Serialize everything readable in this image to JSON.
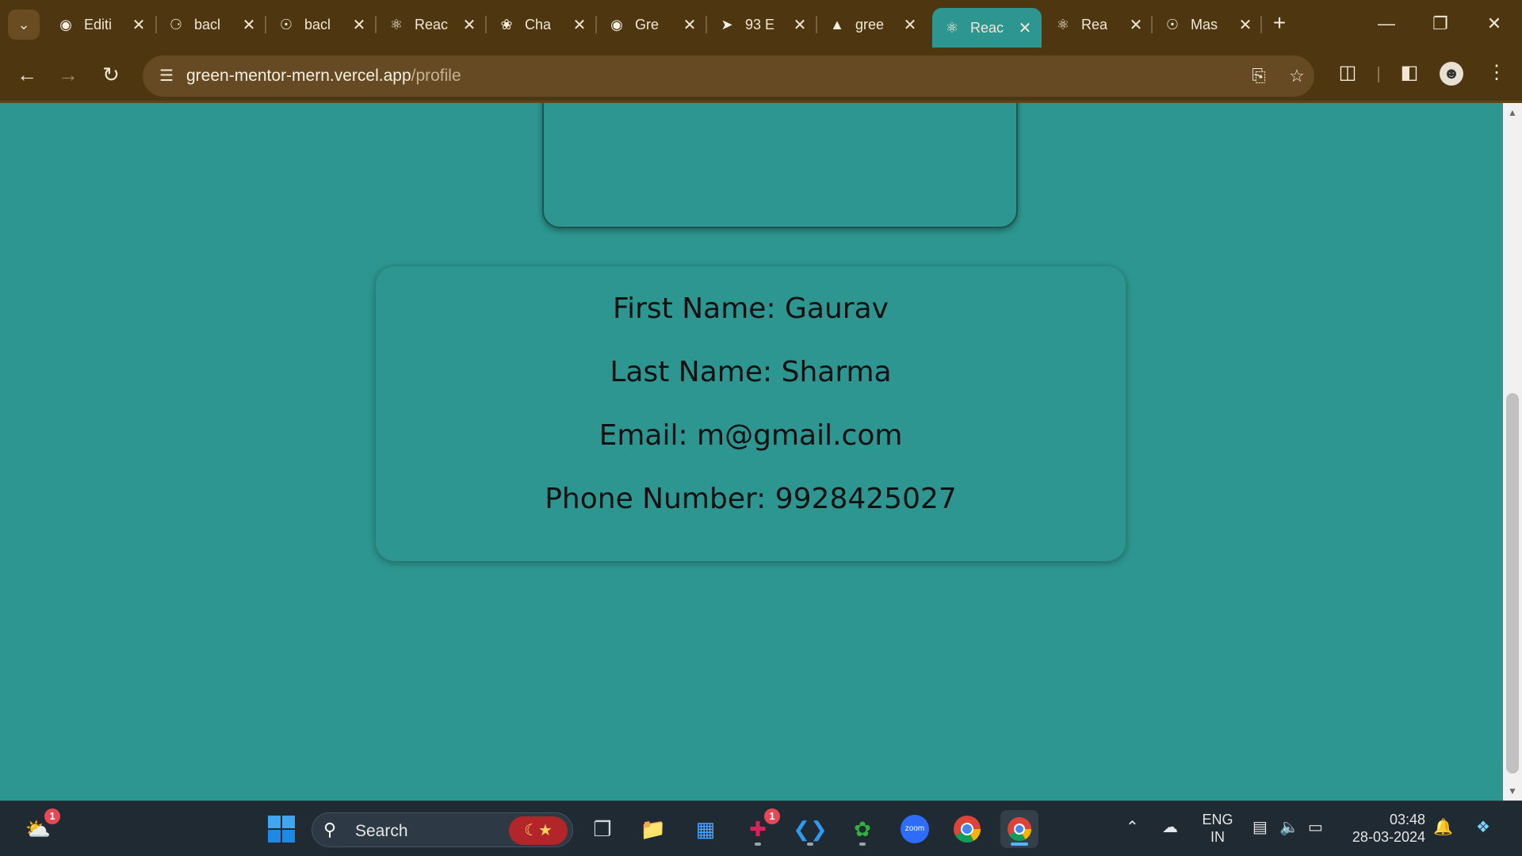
{
  "browser": {
    "tabs": [
      {
        "icon": "github-icon",
        "title": "Editi"
      },
      {
        "icon": "api-tool-icon",
        "title": "bacl"
      },
      {
        "icon": "globe-icon",
        "title": "bacl"
      },
      {
        "icon": "react-icon",
        "title": "Reac"
      },
      {
        "icon": "chatgpt-icon",
        "title": "Cha"
      },
      {
        "icon": "github-icon",
        "title": "Gre"
      },
      {
        "icon": "pointer-icon",
        "title": "93 E"
      },
      {
        "icon": "vercel-icon",
        "title": "gree"
      },
      {
        "icon": "react-icon",
        "title": "Reac",
        "active": true
      },
      {
        "icon": "react-icon",
        "title": "Rea"
      },
      {
        "icon": "globe-icon",
        "title": "Mas"
      }
    ],
    "new_tab_label": "+",
    "url_host": "green-mentor-mern.vercel.app",
    "url_path": "/profile"
  },
  "profile": {
    "first_name": "First Name: Gaurav",
    "last_name": "Last Name: Sharma",
    "email": "Email: m@gmail.com",
    "phone": "Phone Number: 9928425027"
  },
  "taskbar": {
    "search_placeholder": "Search",
    "widgets_badge": "1",
    "slack_badge": "1",
    "lang_line1": "ENG",
    "lang_line2": "IN",
    "time": "03:48",
    "date": "28-03-2024",
    "zoom_label": "zoom"
  },
  "colors": {
    "page_bg": "#2e9690",
    "chrome_bg": "#4e3611",
    "button_blue": "#7eaed8",
    "taskbar_bg": "#1f2a33"
  }
}
